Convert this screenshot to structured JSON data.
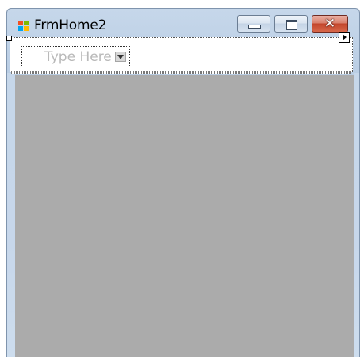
{
  "window": {
    "title": "FrmHome2",
    "icon": "windows-form-icon"
  },
  "caption_buttons": {
    "minimize_icon": "minimize-icon",
    "maximize_icon": "maximize-icon",
    "close_glyph": "✕",
    "close_icon": "close-icon"
  },
  "menu_strip": {
    "placeholder_text": "Type Here",
    "dropdown_icon": "chevron-down-icon"
  },
  "designer": {
    "smart_tag_icon": "smart-tag-arrow-icon",
    "selection_handle": "selection-handle"
  },
  "colors": {
    "client_background": "#ababab",
    "frame": "#c6d7ea",
    "close_button": "#c2452c",
    "placeholder_text": "#b9b9b9"
  }
}
